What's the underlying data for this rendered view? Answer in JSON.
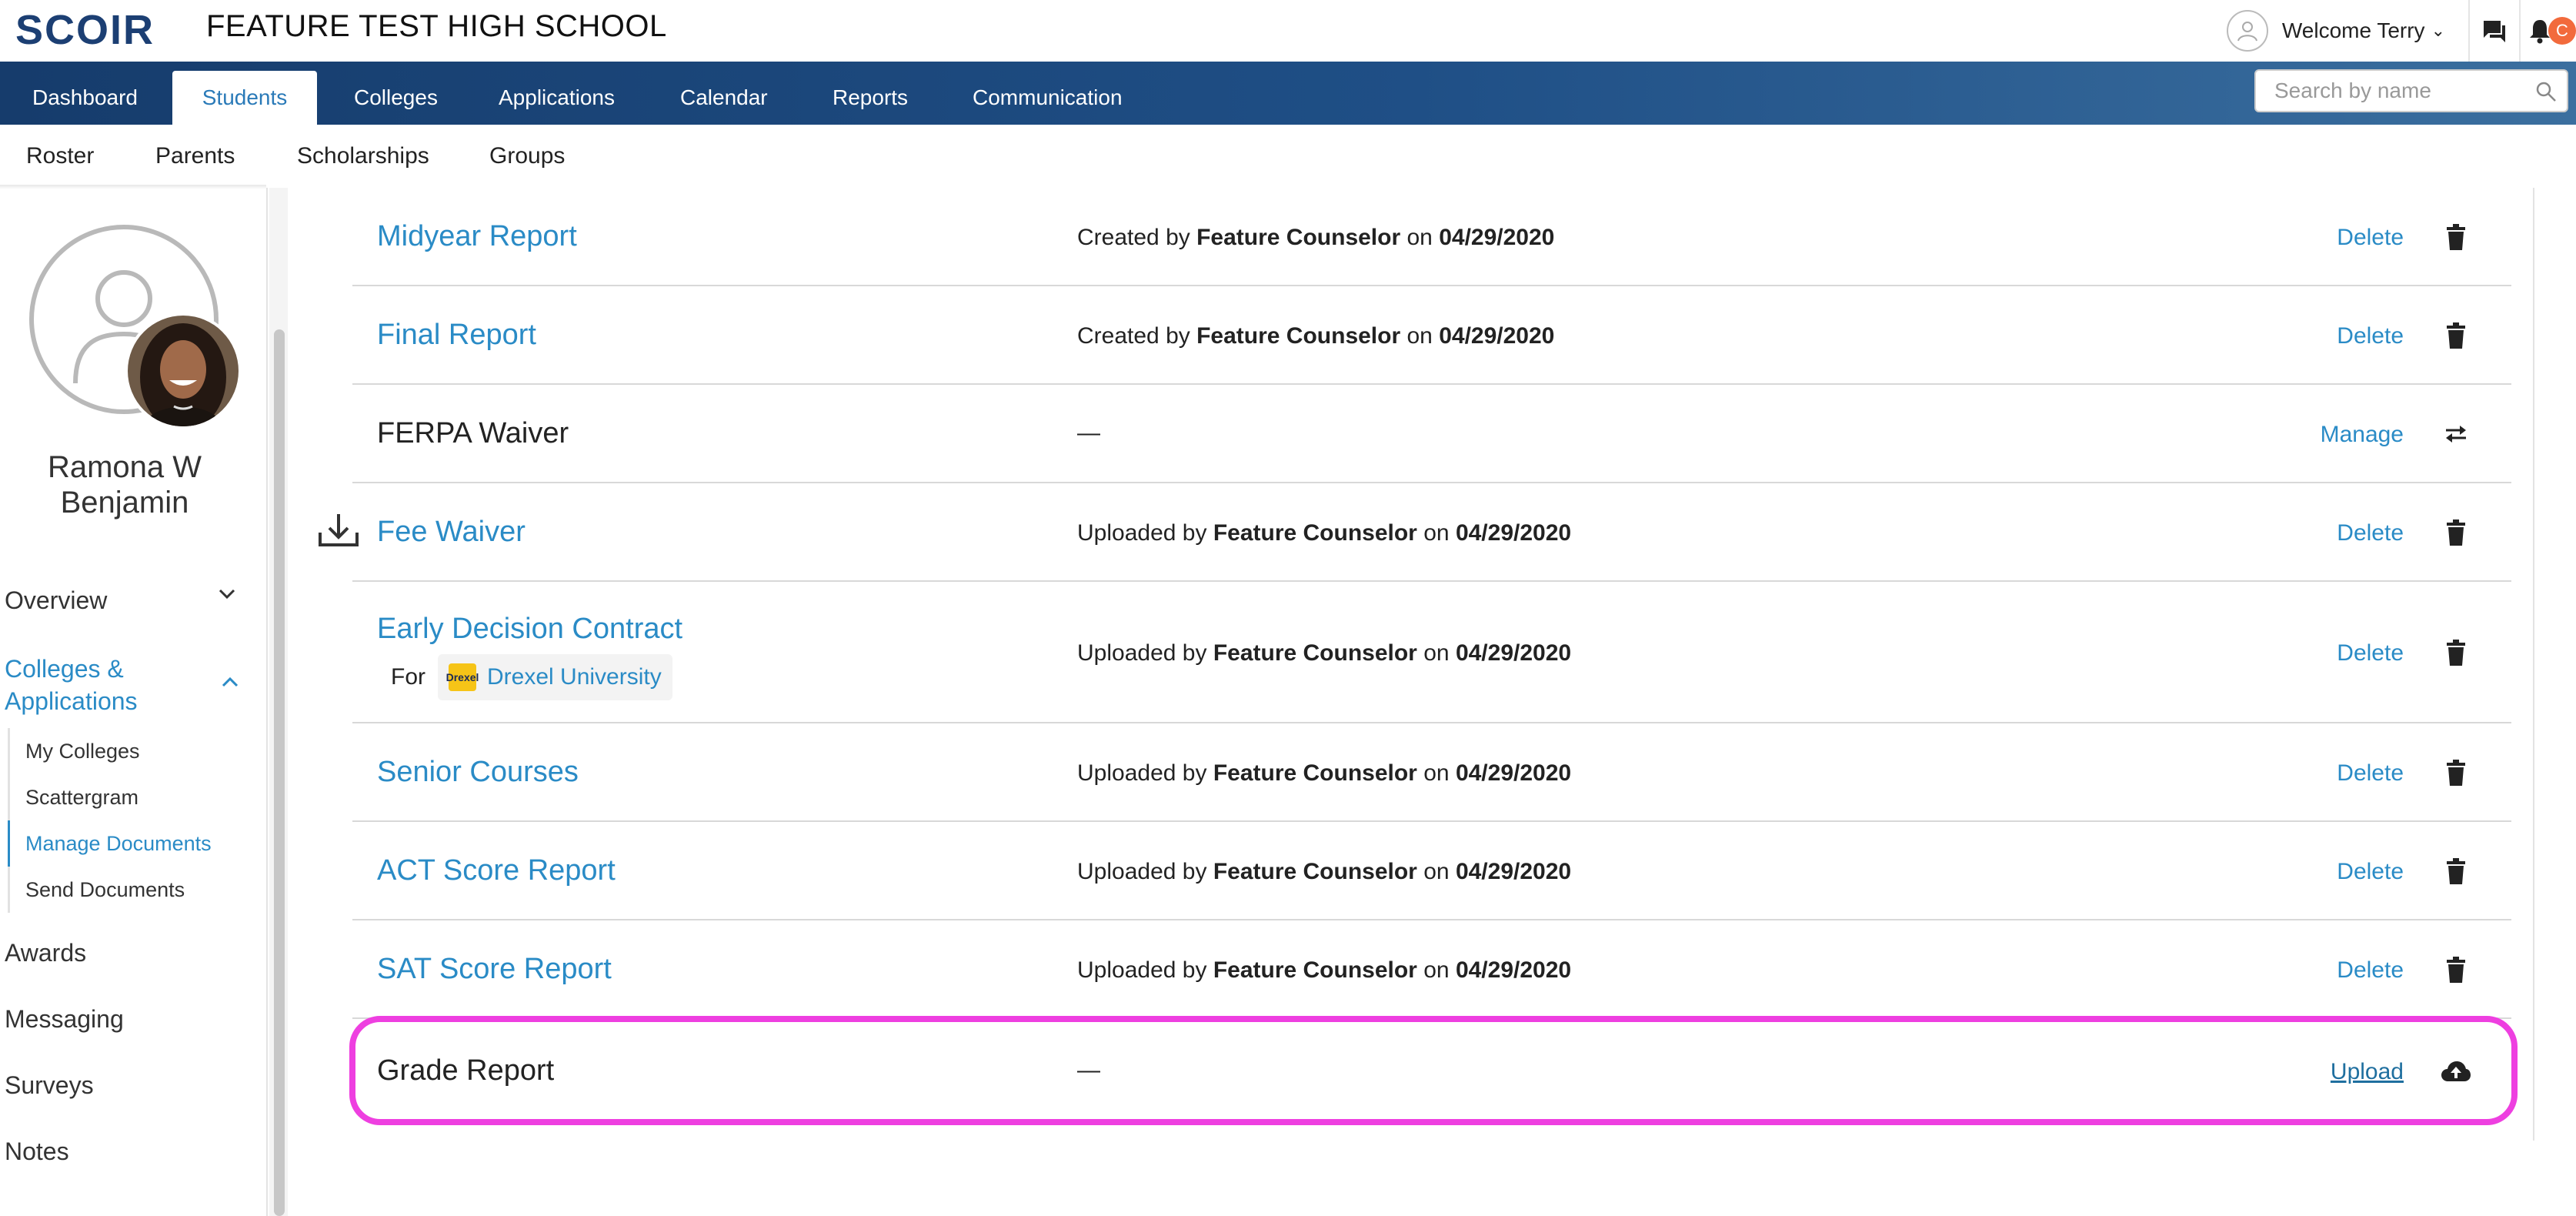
{
  "header": {
    "logo": "SCOIR",
    "school": "FEATURE TEST HIGH SCHOOL",
    "welcome": "Welcome Terry",
    "notification_badge": "C"
  },
  "nav": {
    "tabs": [
      "Dashboard",
      "Students",
      "Colleges",
      "Applications",
      "Calendar",
      "Reports",
      "Communication"
    ],
    "active": "Students",
    "search_placeholder": "Search by name"
  },
  "subnav": {
    "tabs": [
      "Roster",
      "Parents",
      "Scholarships",
      "Groups"
    ]
  },
  "student": {
    "name_line1": "Ramona W",
    "name_line2": "Benjamin"
  },
  "sidebar": {
    "overview": "Overview",
    "colleges_apps_line1": "Colleges &",
    "colleges_apps_line2": "Applications",
    "sub_items": [
      "My Colleges",
      "Scattergram",
      "Manage Documents",
      "Send Documents"
    ],
    "active_sub": "Manage Documents",
    "items": [
      "Awards",
      "Messaging",
      "Surveys",
      "Notes"
    ]
  },
  "documents": [
    {
      "name": "Midyear Report",
      "link": true,
      "verb": "Created by",
      "author": "Feature Counselor",
      "on": "on",
      "date": "04/29/2020",
      "action": "Delete",
      "icon": "trash-icon"
    },
    {
      "name": "Final Report",
      "link": true,
      "verb": "Created by",
      "author": "Feature Counselor",
      "on": "on",
      "date": "04/29/2020",
      "action": "Delete",
      "icon": "trash-icon"
    },
    {
      "name": "FERPA Waiver",
      "link": false,
      "dash": "—",
      "action": "Manage",
      "icon": "swap-arrows-icon"
    },
    {
      "name": "Fee Waiver",
      "link": true,
      "verb": "Uploaded by",
      "author": "Feature Counselor",
      "on": "on",
      "date": "04/29/2020",
      "action": "Delete",
      "icon": "trash-icon"
    },
    {
      "name": "Early Decision Contract",
      "link": true,
      "for_label": "For",
      "college": "Drexel University",
      "college_logo_text": "Drexel",
      "verb": "Uploaded by",
      "author": "Feature Counselor",
      "on": "on",
      "date": "04/29/2020",
      "action": "Delete",
      "icon": "trash-icon"
    },
    {
      "name": "Senior Courses",
      "link": true,
      "verb": "Uploaded by",
      "author": "Feature Counselor",
      "on": "on",
      "date": "04/29/2020",
      "action": "Delete",
      "icon": "trash-icon"
    },
    {
      "name": "ACT Score Report",
      "link": true,
      "verb": "Uploaded by",
      "author": "Feature Counselor",
      "on": "on",
      "date": "04/29/2020",
      "action": "Delete",
      "icon": "trash-icon"
    },
    {
      "name": "SAT Score Report",
      "link": true,
      "verb": "Uploaded by",
      "author": "Feature Counselor",
      "on": "on",
      "date": "04/29/2020",
      "action": "Delete",
      "icon": "trash-icon"
    },
    {
      "name": "Grade Report",
      "link": false,
      "dash": "—",
      "action": "Upload",
      "icon": "cloud-upload-icon"
    }
  ],
  "colors": {
    "nav_dark": "#163c6c",
    "accent_link": "#2a8bc6",
    "highlight": "#ee3fe0",
    "notification": "#f26a3c"
  }
}
